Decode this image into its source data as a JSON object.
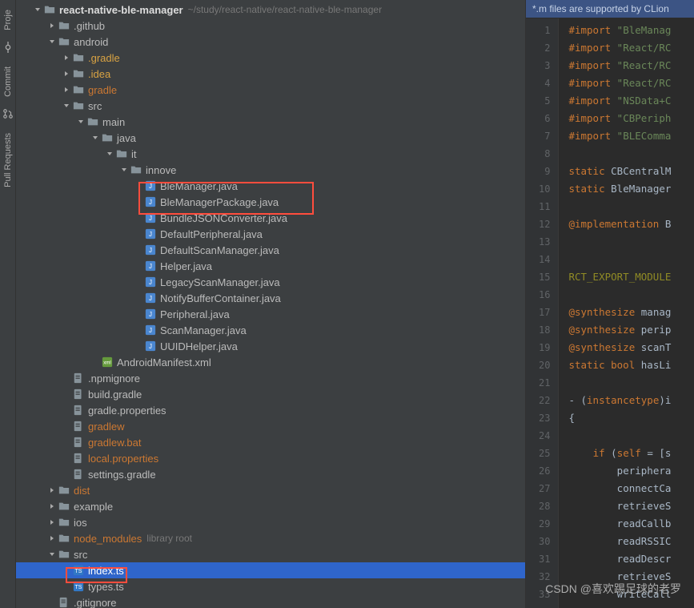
{
  "gutter": {
    "commit": "Commit",
    "pull": "Pull Requests",
    "proj": "Proje"
  },
  "project": {
    "root": "react-native-ble-manager",
    "rootPath": "~/study/react-native/react-native-ble-manager",
    "nodes": [
      {
        "depth": 0,
        "arrow": "down",
        "icon": "folder-root",
        "label": "react-native-ble-manager",
        "bold": true,
        "suffix": "~/study/react-native/react-native-ble-manager"
      },
      {
        "depth": 1,
        "arrow": "right",
        "icon": "folder",
        "label": ".github"
      },
      {
        "depth": 1,
        "arrow": "down",
        "icon": "folder",
        "label": "android"
      },
      {
        "depth": 2,
        "arrow": "right",
        "icon": "folder",
        "label": ".gradle",
        "style": "yellow"
      },
      {
        "depth": 2,
        "arrow": "right",
        "icon": "folder",
        "label": ".idea",
        "style": "yellow"
      },
      {
        "depth": 2,
        "arrow": "right",
        "icon": "folder",
        "label": "gradle",
        "style": "orange"
      },
      {
        "depth": 2,
        "arrow": "down",
        "icon": "folder",
        "label": "src"
      },
      {
        "depth": 3,
        "arrow": "down",
        "icon": "folder",
        "label": "main"
      },
      {
        "depth": 4,
        "arrow": "down",
        "icon": "folder",
        "label": "java"
      },
      {
        "depth": 5,
        "arrow": "down",
        "icon": "folder",
        "label": "it"
      },
      {
        "depth": 6,
        "arrow": "down",
        "icon": "folder",
        "label": "innove"
      },
      {
        "depth": 7,
        "arrow": "",
        "icon": "java",
        "label": "BleManager.java"
      },
      {
        "depth": 7,
        "arrow": "",
        "icon": "java",
        "label": "BleManagerPackage.java"
      },
      {
        "depth": 7,
        "arrow": "",
        "icon": "java",
        "label": "BundleJSONConverter.java"
      },
      {
        "depth": 7,
        "arrow": "",
        "icon": "java",
        "label": "DefaultPeripheral.java"
      },
      {
        "depth": 7,
        "arrow": "",
        "icon": "java",
        "label": "DefaultScanManager.java"
      },
      {
        "depth": 7,
        "arrow": "",
        "icon": "java",
        "label": "Helper.java"
      },
      {
        "depth": 7,
        "arrow": "",
        "icon": "java",
        "label": "LegacyScanManager.java"
      },
      {
        "depth": 7,
        "arrow": "",
        "icon": "java",
        "label": "NotifyBufferContainer.java"
      },
      {
        "depth": 7,
        "arrow": "",
        "icon": "java",
        "label": "Peripheral.java"
      },
      {
        "depth": 7,
        "arrow": "",
        "icon": "java",
        "label": "ScanManager.java"
      },
      {
        "depth": 7,
        "arrow": "",
        "icon": "java",
        "label": "UUIDHelper.java"
      },
      {
        "depth": 4,
        "arrow": "",
        "icon": "xml",
        "label": "AndroidManifest.xml"
      },
      {
        "depth": 2,
        "arrow": "",
        "icon": "file",
        "label": ".npmignore"
      },
      {
        "depth": 2,
        "arrow": "",
        "icon": "file",
        "label": "build.gradle"
      },
      {
        "depth": 2,
        "arrow": "",
        "icon": "file",
        "label": "gradle.properties"
      },
      {
        "depth": 2,
        "arrow": "",
        "icon": "file",
        "label": "gradlew",
        "style": "orange"
      },
      {
        "depth": 2,
        "arrow": "",
        "icon": "file",
        "label": "gradlew.bat",
        "style": "orange"
      },
      {
        "depth": 2,
        "arrow": "",
        "icon": "file",
        "label": "local.properties",
        "style": "orange"
      },
      {
        "depth": 2,
        "arrow": "",
        "icon": "file",
        "label": "settings.gradle"
      },
      {
        "depth": 1,
        "arrow": "right",
        "icon": "folder",
        "label": "dist",
        "style": "orange"
      },
      {
        "depth": 1,
        "arrow": "right",
        "icon": "folder",
        "label": "example"
      },
      {
        "depth": 1,
        "arrow": "right",
        "icon": "folder",
        "label": "ios"
      },
      {
        "depth": 1,
        "arrow": "right",
        "icon": "folder",
        "label": "node_modules",
        "style": "orange",
        "suffix": "library root"
      },
      {
        "depth": 1,
        "arrow": "down",
        "icon": "folder",
        "label": "src"
      },
      {
        "depth": 2,
        "arrow": "",
        "icon": "ts",
        "label": "index.ts",
        "selected": true
      },
      {
        "depth": 2,
        "arrow": "",
        "icon": "ts",
        "label": "types.ts"
      },
      {
        "depth": 1,
        "arrow": "",
        "icon": "file",
        "label": ".gitignore"
      }
    ]
  },
  "editor": {
    "banner": "*.m files are supported by CLion",
    "lines": [
      {
        "n": 1,
        "html": "<span class='kw'>#import</span> <span class='str'>\"BleManag</span>"
      },
      {
        "n": 2,
        "html": "<span class='kw'>#import</span> <span class='str'>\"React/RC</span>"
      },
      {
        "n": 3,
        "html": "<span class='kw'>#import</span> <span class='str'>\"React/RC</span>"
      },
      {
        "n": 4,
        "html": "<span class='kw'>#import</span> <span class='str'>\"React/RC</span>"
      },
      {
        "n": 5,
        "html": "<span class='kw'>#import</span> <span class='str'>\"NSData+C</span>"
      },
      {
        "n": 6,
        "html": "<span class='kw'>#import</span> <span class='str'>\"CBPeriph</span>"
      },
      {
        "n": 7,
        "html": "<span class='kw'>#import</span> <span class='str'>\"BLEComma</span>"
      },
      {
        "n": 8,
        "html": ""
      },
      {
        "n": 9,
        "html": "<span class='kw'>static</span> <span class='ident'>CBCentralM</span>"
      },
      {
        "n": 10,
        "html": "<span class='kw'>static</span> <span class='ident'>BleManager</span>"
      },
      {
        "n": 11,
        "html": ""
      },
      {
        "n": 12,
        "html": "<span class='kw'>@implementation</span> <span class='ident'>B</span>"
      },
      {
        "n": 13,
        "html": ""
      },
      {
        "n": 14,
        "html": ""
      },
      {
        "n": 15,
        "html": "<span class='macro'>RCT_EXPORT_MODULE</span>"
      },
      {
        "n": 16,
        "html": ""
      },
      {
        "n": 17,
        "html": "<span class='kw'>@synthesize</span> <span class='ident'>manag</span>"
      },
      {
        "n": 18,
        "html": "<span class='kw'>@synthesize</span> <span class='ident'>perip</span>"
      },
      {
        "n": 19,
        "html": "<span class='kw'>@synthesize</span> <span class='ident'>scanT</span>"
      },
      {
        "n": 20,
        "html": "<span class='kw'>static bool</span> <span class='ident'>hasLi</span>"
      },
      {
        "n": 21,
        "html": ""
      },
      {
        "n": 22,
        "html": "<span class='ident'>- (</span><span class='kw'>instancetype</span><span class='ident'>)i</span>"
      },
      {
        "n": 23,
        "html": "<span class='ident'>{</span>"
      },
      {
        "n": 24,
        "html": ""
      },
      {
        "n": 25,
        "html": "    <span class='kw'>if</span> <span class='ident'>(</span><span class='kw'>self</span> <span class='ident'>= [s</span>"
      },
      {
        "n": 26,
        "html": "        <span class='ident'>periphera</span>"
      },
      {
        "n": 27,
        "html": "        <span class='ident'>connectCa</span>"
      },
      {
        "n": 28,
        "html": "        <span class='ident'>retrieveS</span>"
      },
      {
        "n": 29,
        "html": "        <span class='ident'>readCallb</span>"
      },
      {
        "n": 30,
        "html": "        <span class='ident'>readRSSIC</span>"
      },
      {
        "n": 31,
        "html": "        <span class='ident'>readDescr</span>"
      },
      {
        "n": 32,
        "html": "        <span class='ident'>retrieveS</span>"
      },
      {
        "n": 33,
        "html": "        <span class='ident'>writeCall</span>"
      }
    ]
  },
  "watermark": "CSDN @喜欢踢足球的老罗"
}
